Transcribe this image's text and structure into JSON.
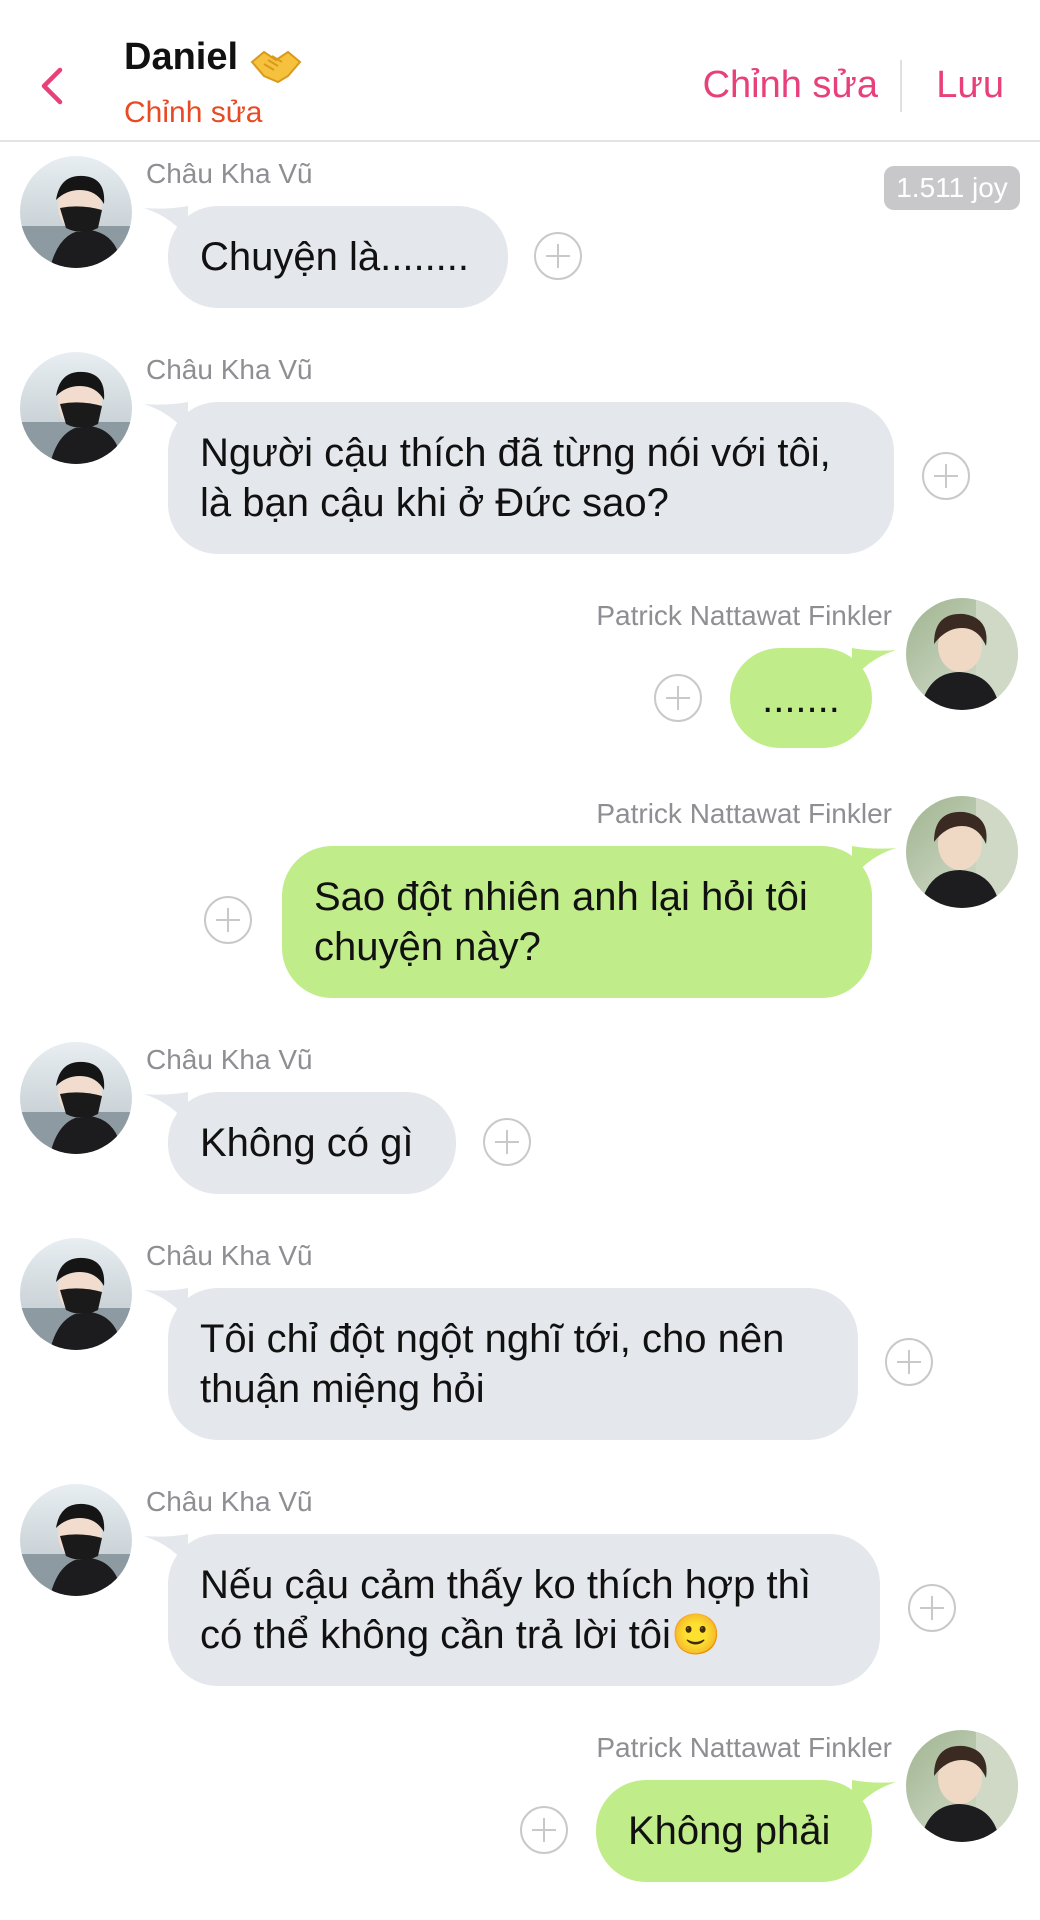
{
  "header": {
    "contact_name": "Daniel",
    "subtitle": "Chỉnh sửa",
    "edit_label": "Chỉnh sửa",
    "save_label": "Lưu"
  },
  "joy_badge": "1.511 joy",
  "colors": {
    "accent": "#e8407a",
    "subtitle": "#e94a23",
    "left_bubble": "#e4e7eb",
    "right_bubble": "#c1ec8a"
  },
  "messages": [
    {
      "side": "left",
      "sender": "Châu Kha Vũ",
      "text": "Chuyện là........"
    },
    {
      "side": "left",
      "sender": "Châu Kha Vũ",
      "line1": "Người cậu thích đã từng nói với tôi,",
      "line2": "là bạn cậu khi ở Đức sao?"
    },
    {
      "side": "right",
      "sender": "Patrick Nattawat Finkler",
      "text": "......."
    },
    {
      "side": "right",
      "sender": "Patrick Nattawat Finkler",
      "line1": "Sao đột nhiên anh lại hỏi tôi",
      "line2": "chuyện này?"
    },
    {
      "side": "left",
      "sender": "Châu Kha Vũ",
      "text": "Không có gì"
    },
    {
      "side": "left",
      "sender": "Châu Kha Vũ",
      "line1": "Tôi chỉ đột ngột nghĩ tới, cho nên",
      "line2": "thuận miệng hỏi"
    },
    {
      "side": "left",
      "sender": "Châu Kha Vũ",
      "line1": "Nếu cậu cảm thấy ko thích hợp thì",
      "line2": "có thể không cần trả lời tôi🙂"
    },
    {
      "side": "right",
      "sender": "Patrick Nattawat Finkler",
      "text": "Không phải"
    }
  ]
}
